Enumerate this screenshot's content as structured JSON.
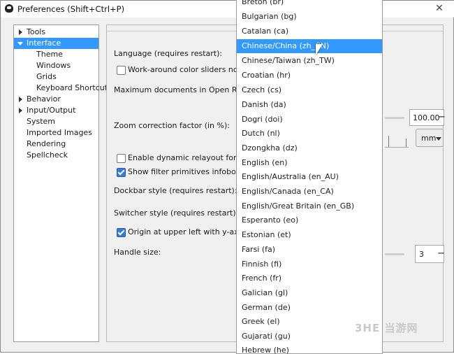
{
  "window": {
    "title": "Preferences (Shift+Ctrl+P)",
    "close_glyph": "✕"
  },
  "tree": {
    "items": [
      {
        "label": "Tools"
      },
      {
        "label": "Interface"
      },
      {
        "label": "Theme"
      },
      {
        "label": "Windows"
      },
      {
        "label": "Grids"
      },
      {
        "label": "Keyboard Shortcuts"
      },
      {
        "label": "Behavior"
      },
      {
        "label": "Input/Output"
      },
      {
        "label": "System"
      },
      {
        "label": "Imported Images"
      },
      {
        "label": "Rendering"
      },
      {
        "label": "Spellcheck"
      }
    ]
  },
  "content": {
    "language_label": "Language (requires restart):",
    "workaround_label": "Work-around color sliders not drawin",
    "max_docs_label": "Maximum documents in Open Recent:",
    "zoom_label": "Zoom correction factor (in %):",
    "zoom_value": "100.00",
    "zoom_minus": "−",
    "unit_value": "mm",
    "dynamic_relayout_label": "Enable dynamic relayout for incompl",
    "filter_infobox_label": "Show filter primitives infobox (requir",
    "dockbar_label": "Dockbar style (requires restart):",
    "switcher_label": "Switcher style (requires restart):",
    "origin_label": "Origin at upper left with y-axis point",
    "handle_label": "Handle size:",
    "handle_value": "3",
    "handle_minus": "−",
    "checks": {
      "workaround": false,
      "dynamic_relayout": false,
      "filter_infobox": true,
      "origin": true
    }
  },
  "dropdown": {
    "items": [
      "Breton (br)",
      "Bulgarian (bg)",
      "Catalan (ca)",
      "Chinese/China (zh_CN)",
      "Chinese/Taiwan (zh_TW)",
      "Croatian (hr)",
      "Czech (cs)",
      "Danish (da)",
      "Dogri (doi)",
      "Dutch (nl)",
      "Dzongkha (dz)",
      "English (en)",
      "English/Australia (en_AU)",
      "English/Canada (en_CA)",
      "English/Great Britain (en_GB)",
      "Esperanto (eo)",
      "Estonian (et)",
      "Farsi (fa)",
      "Finnish (fi)",
      "French (fr)",
      "Galician (gl)",
      "German (de)",
      "Greek (el)",
      "Gujarati (gu)",
      "Hebrew (he)"
    ],
    "highlighted": "Chinese/China (zh_CN)"
  },
  "watermark": {
    "text": "3HE 当游网"
  }
}
